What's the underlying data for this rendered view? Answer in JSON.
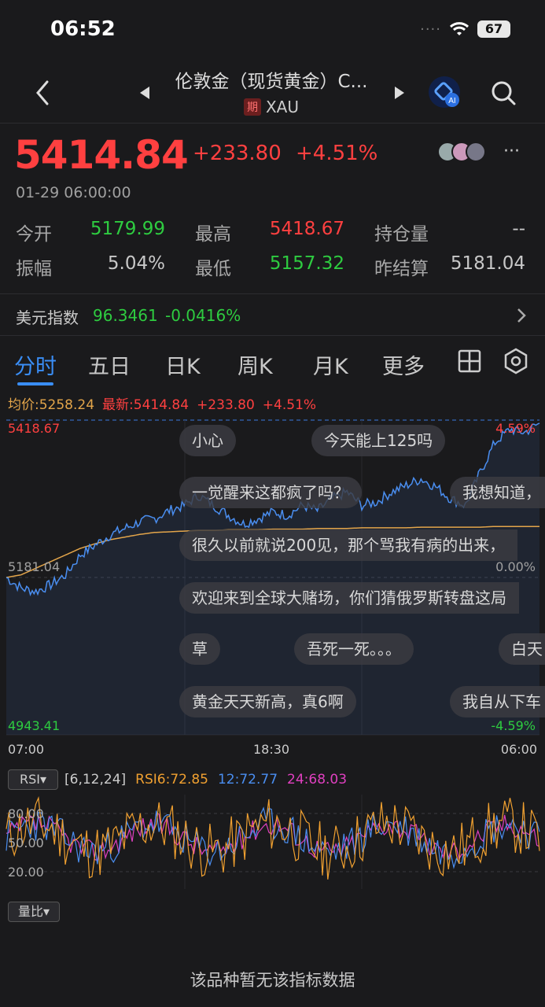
{
  "status_bar": {
    "time": "06:52",
    "signal": "····",
    "battery": "67"
  },
  "nav": {
    "title": "伦敦金（现货黄金）C...",
    "badge": "期",
    "symbol": "XAU"
  },
  "quote": {
    "price": "5414.84",
    "change": "+233.80",
    "change_pct": "+4.51%",
    "timestamp": "01-29 06:00:00"
  },
  "stats": [
    {
      "label": "今开",
      "value": "5179.99",
      "color": "#2ecc40"
    },
    {
      "label": "最高",
      "value": "5418.67",
      "color": "#ff4040"
    },
    {
      "label": "持仓量",
      "value": "--",
      "color": "#c8c8c8"
    },
    {
      "label": "振幅",
      "value": "5.04%",
      "color": "#c8c8c8"
    },
    {
      "label": "最低",
      "value": "5157.32",
      "color": "#2ecc40"
    },
    {
      "label": "昨结算",
      "value": "5181.04",
      "color": "#c8c8c8"
    }
  ],
  "usd_index": {
    "label": "美元指数",
    "value": "96.3461",
    "change": "-0.0416%"
  },
  "tabs": [
    "分时",
    "五日",
    "日K",
    "周K",
    "月K",
    "更多"
  ],
  "legend": {
    "avg": "均价:5258.24",
    "latest": "最新:5414.84",
    "chg": "+233.80",
    "pct": "+4.51%"
  },
  "chart_data": {
    "type": "line",
    "x_ticks": [
      "07:00",
      "18:30",
      "06:00"
    ],
    "y_left": {
      "top": "5418.67",
      "mid": "5181.04",
      "bottom": "4943.41"
    },
    "y_right": {
      "top": "4.59%",
      "mid": "0.00%",
      "bottom": "-4.59%"
    },
    "series": [
      {
        "values": [
          5181,
          5165,
          5160,
          5170,
          5185,
          5215,
          5230,
          5245,
          5255,
          5265,
          5270,
          5282,
          5290,
          5305,
          5290,
          5275,
          5262,
          5270,
          5280,
          5275,
          5290,
          5282,
          5300,
          5310,
          5290,
          5295,
          5310,
          5320,
          5330,
          5318,
          5300,
          5290,
          5340,
          5385,
          5405,
          5400,
          5414
        ]
      },
      {
        "values": [
          5181,
          5185,
          5195,
          5205,
          5215,
          5225,
          5232,
          5238,
          5242,
          5246,
          5249,
          5250,
          5251,
          5252,
          5252,
          5253,
          5253,
          5253,
          5254,
          5254,
          5254,
          5255,
          5255,
          5255,
          5256,
          5256,
          5256,
          5256,
          5257,
          5257,
          5257,
          5257,
          5257,
          5258,
          5258,
          5258,
          5258
        ]
      }
    ],
    "colors": {
      "price": "#4a8ef0",
      "avg": "#e3a54a"
    }
  },
  "bubbles": [
    "小心",
    "今天能上125吗",
    "一觉醒来这都疯了吗？",
    "我想知道，",
    "很久以前就说200见，那个骂我有病的出来，",
    "欢迎来到全球大赌场，你们猜俄罗斯转盘这局",
    "草",
    "吾死一死。。。",
    "白天",
    "黄金天天新高，真6啊",
    "我自从下车"
  ],
  "rsi": {
    "selector": "RSI▾",
    "params": "[6,12,24]",
    "rsi6": "RSI6:72.85",
    "rsi12": "12:72.77",
    "rsi24": "24:68.03",
    "y_ticks": [
      "80.00",
      "50.00",
      "20.00"
    ],
    "colors": {
      "rsi6": "#f0a030",
      "rsi12": "#4a8ef0",
      "rsi24": "#e040c0"
    }
  },
  "ratio": {
    "selector": "量比▾",
    "no_data": "该品种暂无该指标数据"
  }
}
